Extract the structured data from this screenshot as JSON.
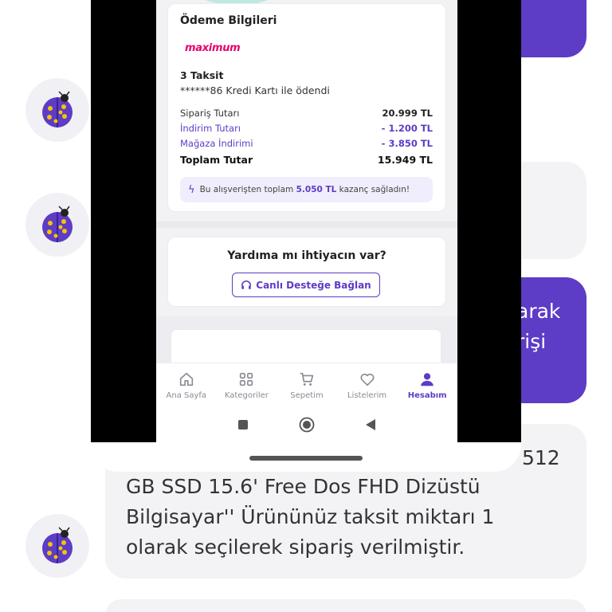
{
  "chat": {
    "purple_top_text": "",
    "purple_mid_line1": "arak",
    "purple_mid_line2": "rişi",
    "grey_message_tail": "512",
    "grey_message_line2": "GB SSD 15.6' Free Dos FHD Dizüstü",
    "grey_message_line3": "Bilgisayar'' Ürününüz taksit miktarı 1",
    "grey_message_line4": "olarak seçilerek sipariş verilmiştir."
  },
  "payment": {
    "title": "Ödeme Bilgileri",
    "brand": "maximum",
    "installment": "3 Taksit",
    "card_info": "******86 Kredi Kartı ile ödendi",
    "rows": [
      {
        "label": "Sipariş Tutarı",
        "value": "20.999 TL"
      },
      {
        "label": "İndirim Tutarı",
        "value": "- 1.200 TL"
      },
      {
        "label": "Mağaza İndirimi",
        "value": "- 3.850 TL"
      }
    ],
    "total": {
      "label": "Toplam Tutar",
      "value": "15.949 TL"
    },
    "gain_prefix": "Bu alışverişten toplam",
    "gain_amount": "5.050 TL",
    "gain_suffix": "kazanç sağladın!"
  },
  "help": {
    "title": "Yardıma mı ihtiyacın var?",
    "button": "Canlı Desteğe Bağlan"
  },
  "nav": [
    {
      "label": "Ana Sayfa",
      "icon": "home-icon"
    },
    {
      "label": "Kategoriler",
      "icon": "grid-icon"
    },
    {
      "label": "Sepetim",
      "icon": "cart-icon"
    },
    {
      "label": "Listelerim",
      "icon": "heart-icon"
    },
    {
      "label": "Hesabım",
      "icon": "user-icon"
    }
  ],
  "colors": {
    "accent": "#5d3cc6",
    "brand_pink": "#e5006d",
    "chat_grey": "#f3f3f6"
  }
}
